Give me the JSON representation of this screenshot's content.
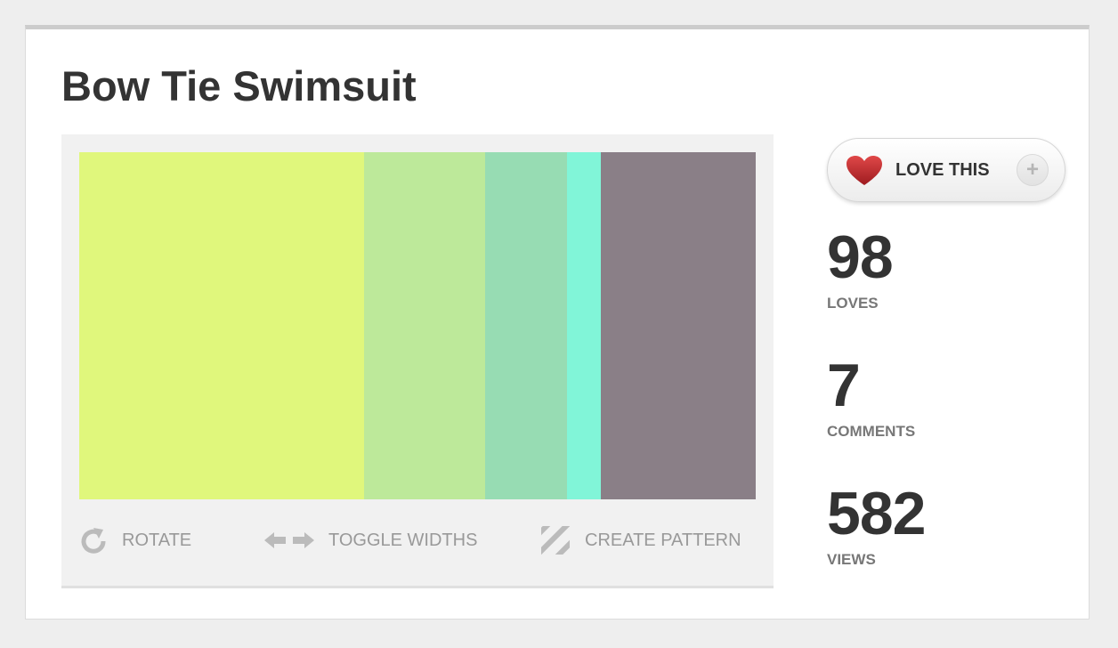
{
  "title": "Bow Tie Swimsuit",
  "palette": {
    "swatches": [
      {
        "color": "#e0f77c",
        "width_fraction": 0.421
      },
      {
        "color": "#bde99a",
        "width_fraction": 0.179
      },
      {
        "color": "#97dcb3",
        "width_fraction": 0.121
      },
      {
        "color": "#81f5d8",
        "width_fraction": 0.05
      },
      {
        "color": "#8a7f87",
        "width_fraction": 0.229
      }
    ]
  },
  "toolbar": {
    "rotate": {
      "label": "ROTATE",
      "icon": "rotate-icon"
    },
    "toggle_widths": {
      "label": "TOGGLE WIDTHS",
      "icon": "double-arrow-icon"
    },
    "create_pattern": {
      "label": "CREATE PATTERN",
      "icon": "stripes-icon"
    }
  },
  "love_button": {
    "label": "LOVE THIS",
    "plus": "+",
    "icon": "heart-icon",
    "heart_color": "#c0282d"
  },
  "stats": {
    "loves": {
      "value": "98",
      "label": "LOVES"
    },
    "comments": {
      "value": "7",
      "label": "COMMENTS"
    },
    "views": {
      "value": "582",
      "label": "VIEWS"
    }
  }
}
